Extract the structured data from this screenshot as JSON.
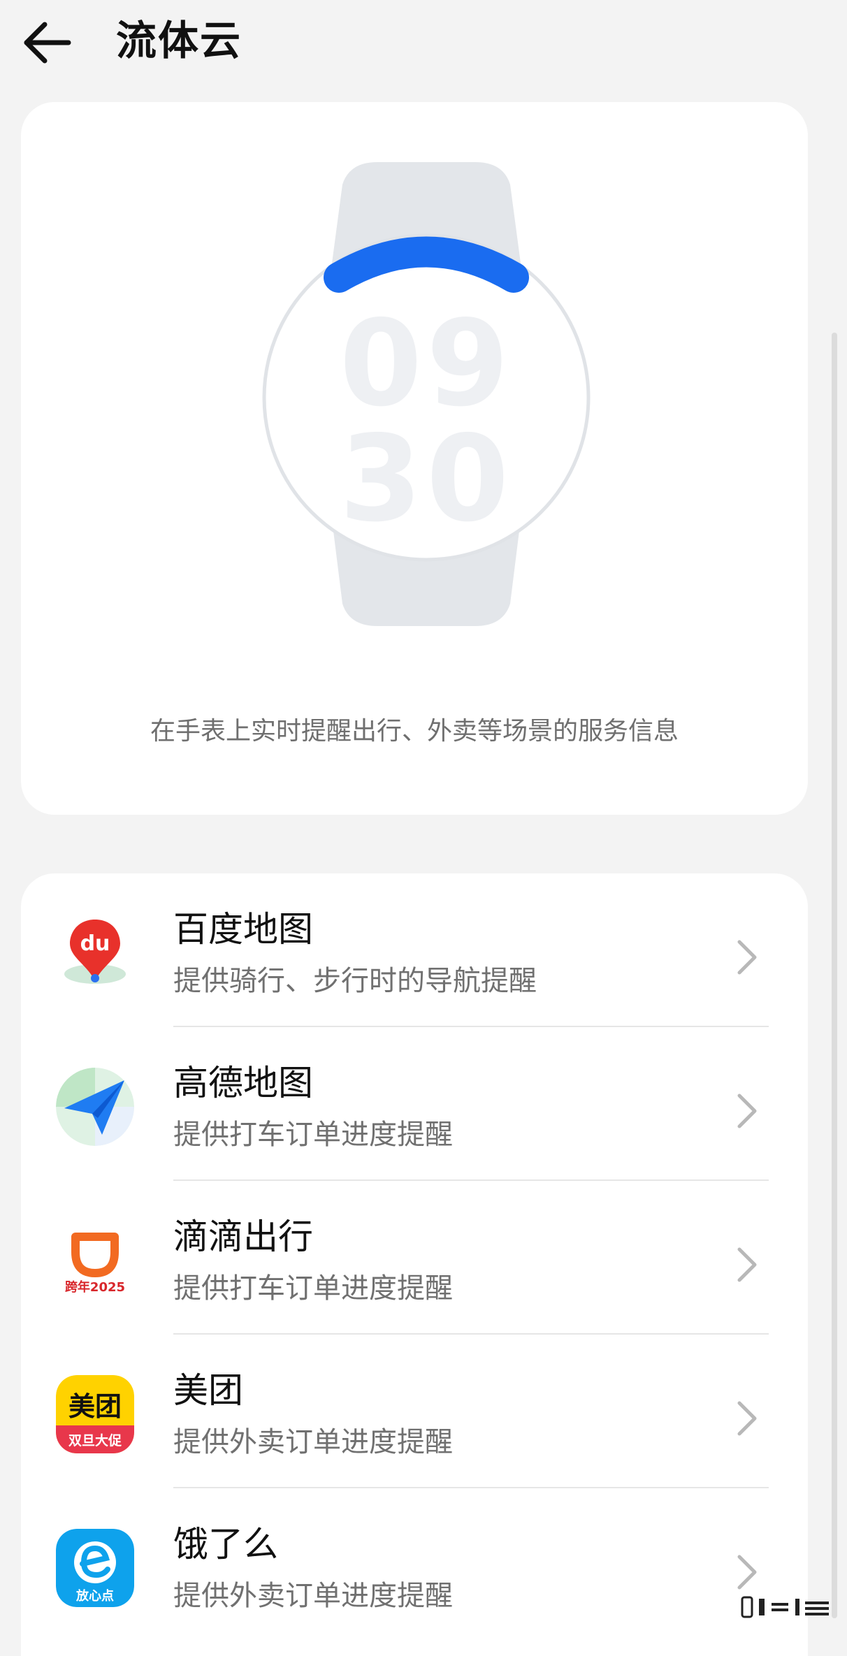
{
  "header": {
    "title": "流体云"
  },
  "hero": {
    "description": "在手表上实时提醒出行、外卖等场景的服务信息",
    "watch_time": "09 30",
    "accent_color": "#1a6cf0"
  },
  "apps": [
    {
      "name": "百度地图",
      "desc": "提供骑行、步行时的导航提醒",
      "icon": "baidu-map-icon"
    },
    {
      "name": "高德地图",
      "desc": "提供打车订单进度提醒",
      "icon": "amap-icon"
    },
    {
      "name": "滴滴出行",
      "desc": "提供打车订单进度提醒",
      "icon": "didi-icon"
    },
    {
      "name": "美团",
      "desc": "提供外卖订单进度提醒",
      "icon": "meituan-icon"
    },
    {
      "name": "饿了么",
      "desc": "提供外卖订单进度提醒",
      "icon": "eleme-icon"
    }
  ],
  "icon_text": {
    "baidu": "du",
    "didi": "跨年2025",
    "meituan_top": "美团",
    "meituan_bottom": "双旦大促",
    "eleme_bottom": "放心点"
  },
  "colors": {
    "background": "#f3f3f3",
    "card": "#ffffff",
    "text_primary": "#111111",
    "text_secondary": "#707070",
    "divider": "#e6e6e6"
  }
}
